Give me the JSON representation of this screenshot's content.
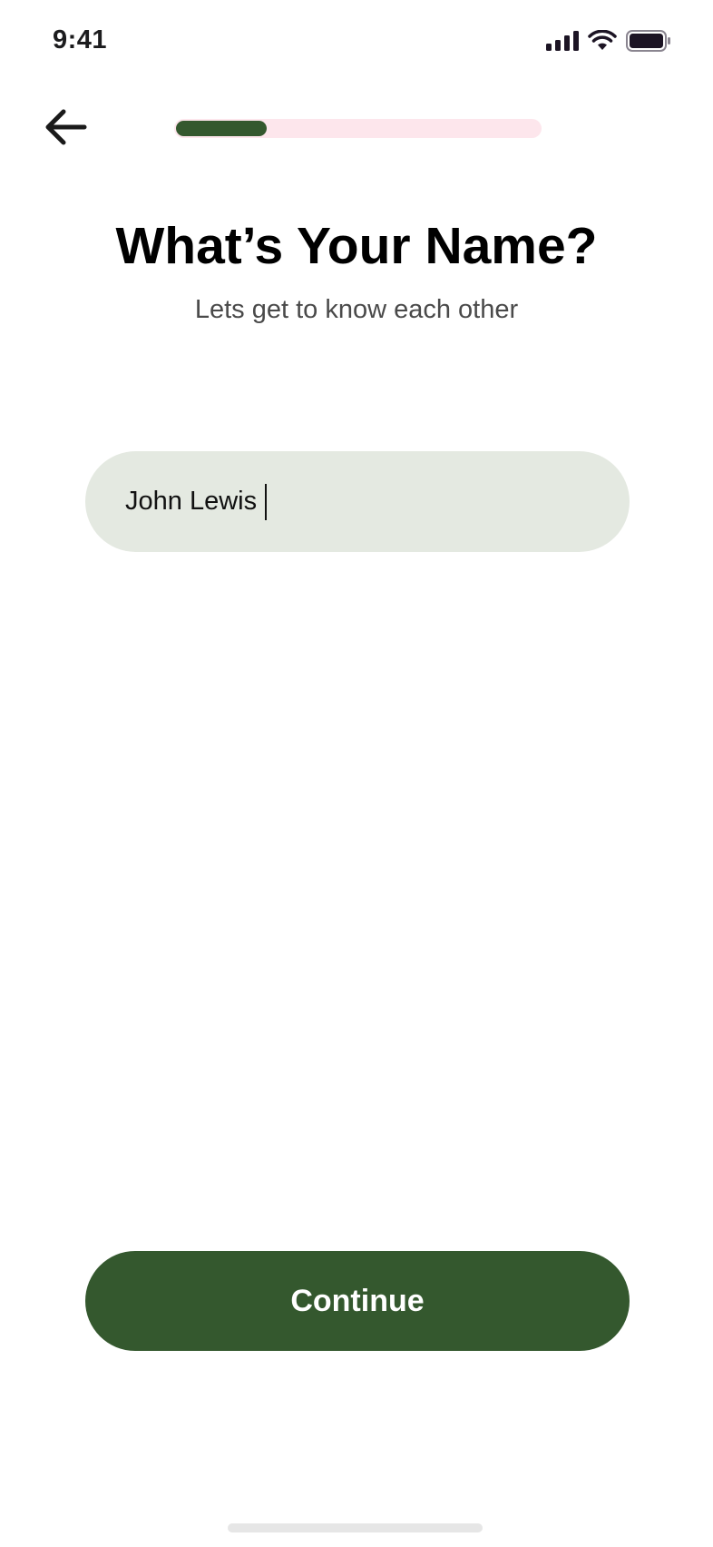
{
  "status_bar": {
    "time": "9:41",
    "icons": [
      "cellular-signal-icon",
      "wifi-icon",
      "battery-icon"
    ]
  },
  "header": {
    "back_icon": "arrow-left-icon",
    "progress": 0.25
  },
  "main": {
    "title": "What’s Your Name?",
    "subtitle": "Lets get to know each other",
    "name_field_value": "John Lewis"
  },
  "footer": {
    "continue_label": "Continue"
  },
  "colors": {
    "accent": "#34582e",
    "progress_track": "#fde6ec",
    "input_background": "#e4e9e1"
  }
}
